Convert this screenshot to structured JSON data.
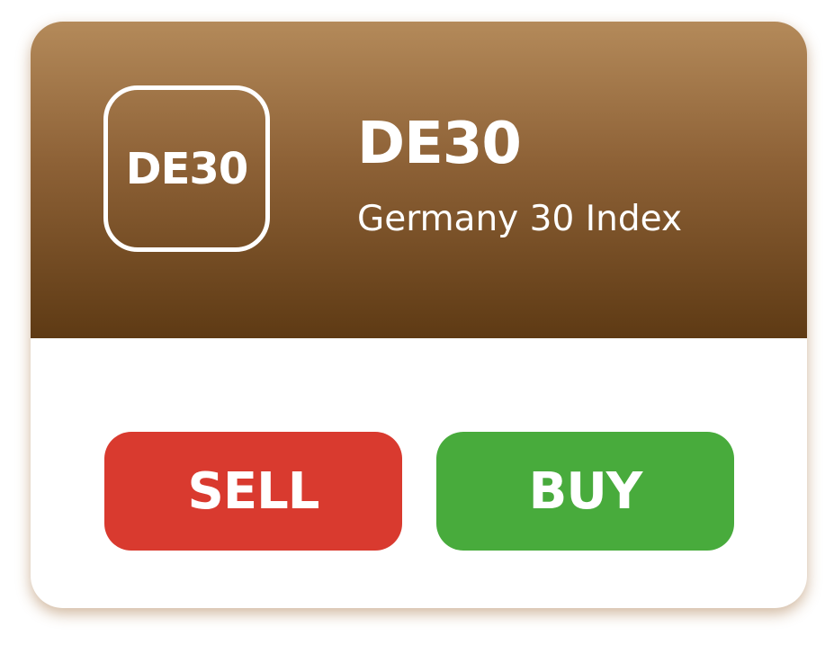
{
  "instrument": {
    "badge_text": "DE30",
    "symbol": "DE30",
    "name": "Germany 30 Index"
  },
  "actions": {
    "sell_label": "SELL",
    "buy_label": "BUY"
  },
  "colors": {
    "header_top": "#b48a5a",
    "header_bottom": "#5e3a14",
    "sell": "#d93a2f",
    "buy": "#48ab3c",
    "text": "#ffffff"
  }
}
